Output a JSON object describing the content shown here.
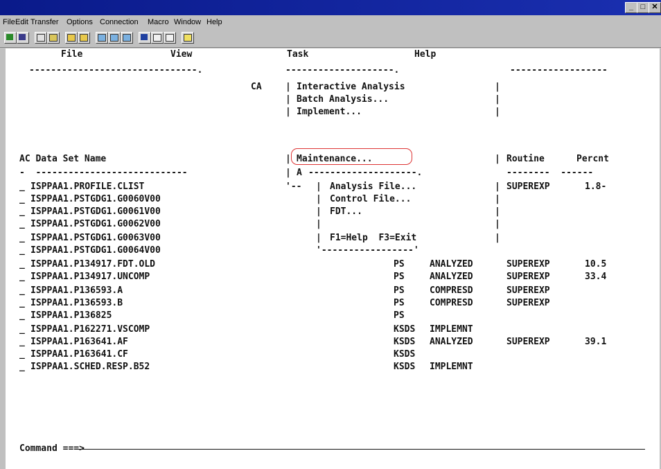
{
  "window": {
    "min_glyph": "_",
    "max_glyph": "□",
    "close_glyph": "✕"
  },
  "menubar": [
    "File",
    "Edit",
    "Transfer",
    "Options",
    "Connection",
    "Macro",
    "Window",
    "Help"
  ],
  "ispf_menu": {
    "file": "File",
    "view": "View",
    "task": "Task",
    "help": "Help"
  },
  "header": {
    "sep_left": "-------------------------------.",
    "sep_right": "------------------",
    "sep_mid": "--------------------.",
    "ca": "CA",
    "col_ac_ds": "AC Data Set Name",
    "dash_left": "-  ----------------------------",
    "routine": "Routine",
    "percnt": "Percnt",
    "dash_right": "--------  ------"
  },
  "task_menu": {
    "items": [
      "Interactive Analysis",
      "Batch Analysis...",
      "Implement...",
      "Maintenance..."
    ],
    "a_prefix": "A",
    "sub_border": "--------------------.",
    "corner_left": "'--",
    "sub_items": [
      "Analysis File...",
      "Control File...",
      "FDT..."
    ],
    "keys": "F1=Help  F3=Exit",
    "bottom_border": "'-----------------'"
  },
  "datasets": [
    {
      "sel": "_",
      "name": "ISPPAA1.PROFILE.CLIST",
      "org": "",
      "status": "",
      "routine": "SUPEREXP",
      "pct": "1.8-"
    },
    {
      "sel": "_",
      "name": "ISPPAA1.PSTGDG1.G0060V00",
      "org": "",
      "status": "",
      "routine": "",
      "pct": ""
    },
    {
      "sel": "_",
      "name": "ISPPAA1.PSTGDG1.G0061V00",
      "org": "",
      "status": "",
      "routine": "",
      "pct": ""
    },
    {
      "sel": "_",
      "name": "ISPPAA1.PSTGDG1.G0062V00",
      "org": "",
      "status": "",
      "routine": "",
      "pct": ""
    },
    {
      "sel": "_",
      "name": "ISPPAA1.PSTGDG1.G0063V00",
      "org": "",
      "status": "",
      "routine": "",
      "pct": ""
    },
    {
      "sel": "_",
      "name": "ISPPAA1.PSTGDG1.G0064V00",
      "org": "",
      "status": "",
      "routine": "",
      "pct": ""
    },
    {
      "sel": "_",
      "name": "ISPPAA1.P134917.FDT.OLD",
      "org": "PS",
      "status": "ANALYZED",
      "routine": "SUPEREXP",
      "pct": "10.5"
    },
    {
      "sel": "_",
      "name": "ISPPAA1.P134917.UNCOMP",
      "org": "PS",
      "status": "ANALYZED",
      "routine": "SUPEREXP",
      "pct": "33.4"
    },
    {
      "sel": "_",
      "name": "ISPPAA1.P136593.A",
      "org": "PS",
      "status": "COMPRESD",
      "routine": "SUPEREXP",
      "pct": ""
    },
    {
      "sel": "_",
      "name": "ISPPAA1.P136593.B",
      "org": "PS",
      "status": "COMPRESD",
      "routine": "SUPEREXP",
      "pct": ""
    },
    {
      "sel": "_",
      "name": "ISPPAA1.P136825",
      "org": "PS",
      "status": "",
      "routine": "",
      "pct": ""
    },
    {
      "sel": "_",
      "name": "ISPPAA1.P162271.VSCOMP",
      "org": "KSDS",
      "status": "IMPLEMNT",
      "routine": "",
      "pct": ""
    },
    {
      "sel": "_",
      "name": "ISPPAA1.P163641.AF",
      "org": "KSDS",
      "status": "ANALYZED",
      "routine": "SUPEREXP",
      "pct": "39.1"
    },
    {
      "sel": "_",
      "name": "ISPPAA1.P163641.CF",
      "org": "KSDS",
      "status": "",
      "routine": "",
      "pct": ""
    },
    {
      "sel": "_",
      "name": "ISPPAA1.SCHED.RESP.B52",
      "org": "KSDS",
      "status": "IMPLEMNT",
      "routine": "",
      "pct": ""
    }
  ],
  "command": {
    "label": "Command ===>"
  }
}
